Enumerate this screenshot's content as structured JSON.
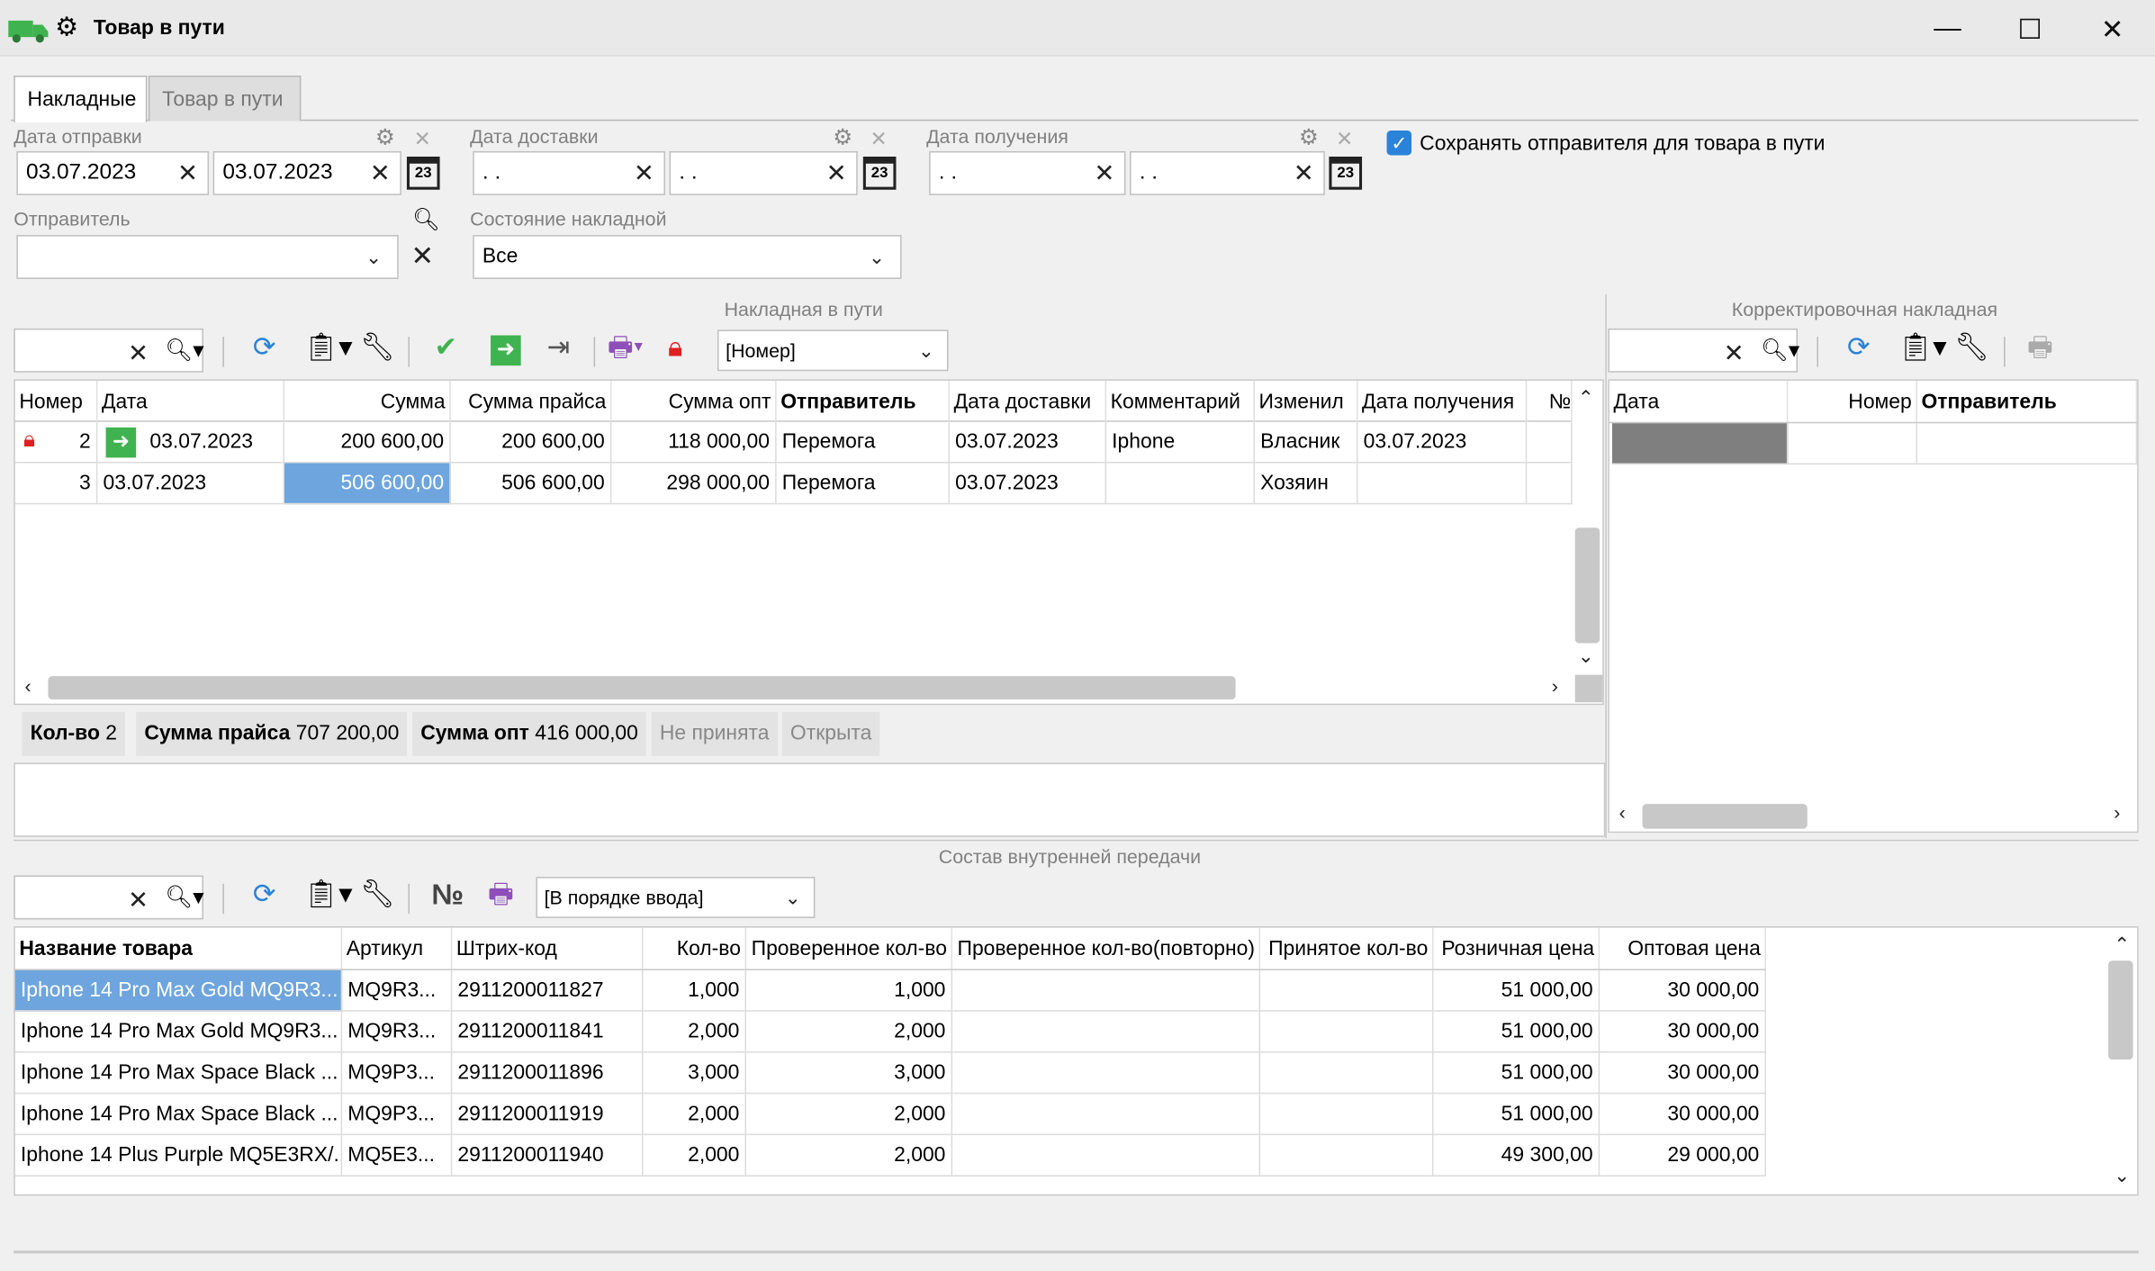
{
  "window": {
    "title": "Товар в пути",
    "minimize": "—",
    "maximize": "☐",
    "close": "✕"
  },
  "tabs": [
    "Накладные",
    "Товар в пути"
  ],
  "filters": {
    "ship_date": {
      "label": "Дата отправки",
      "from": "03.07.2023",
      "to": "03.07.2023"
    },
    "delivery_date": {
      "label": "Дата доставки",
      "from": " .  .",
      "to": " .  ."
    },
    "receive_date": {
      "label": "Дата получения",
      "from": " .  .",
      "to": " .  ."
    },
    "save_sender": {
      "label": "Сохранять отправителя для товара в пути",
      "checked": true
    },
    "sender": {
      "label": "Отправитель",
      "value": ""
    },
    "invoice_state": {
      "label": "Состояние накладной",
      "value": "Все"
    },
    "calendar_glyph": "23"
  },
  "invoices": {
    "section_title": "Накладная в пути",
    "sort_select": "[Номер]",
    "columns": [
      "Номер",
      "Дата",
      "Сумма",
      "Сумма прайса",
      "Сумма опт",
      "Отправитель",
      "Дата доставки",
      "Комментарий",
      "Изменил",
      "Дата получения",
      "№"
    ],
    "rows": [
      {
        "num": "2",
        "date": "03.07.2023",
        "sum": "200 600,00",
        "price_sum": "200 600,00",
        "opt_sum": "118 000,00",
        "sender": "Перемога",
        "delivery": "03.07.2023",
        "comment": "Iphone",
        "changed": "Власник",
        "received": "03.07.2023",
        "locked": true
      },
      {
        "num": "3",
        "date": "03.07.2023",
        "sum": "506 600,00",
        "price_sum": "506 600,00",
        "opt_sum": "298 000,00",
        "sender": "Перемога",
        "delivery": "03.07.2023",
        "comment": "",
        "changed": "Хозяин",
        "received": "",
        "locked": false
      }
    ],
    "summary": {
      "count_label": "Кол-во",
      "count": "2",
      "price_label": "Сумма прайса",
      "price": "707 200,00",
      "opt_label": "Сумма опт",
      "opt": "416 000,00",
      "status1": "Не принята",
      "status2": "Открыта"
    }
  },
  "corrections": {
    "section_title": "Корректировочная накладная",
    "columns": [
      "Дата",
      "Номер",
      "Отправитель"
    ]
  },
  "composition": {
    "section_title": "Состав внутренней передачи",
    "order_select": "[В порядке ввода]",
    "num_icon": "№",
    "columns": [
      "Название товара",
      "Артикул",
      "Штрих-код",
      "Кол-во",
      "Проверенное кол-во",
      "Проверенное кол-во(повторно)",
      "Принятое кол-во",
      "Розничная цена",
      "Оптовая цена"
    ],
    "rows": [
      {
        "name": "Iphone 14  Pro Max Gold MQ9R3...",
        "sku": "MQ9R3...",
        "barcode": "2911200011827",
        "qty": "1,000",
        "checked": "1,000",
        "checked2": "",
        "accepted": "",
        "retail": "51 000,00",
        "wholesale": "30 000,00"
      },
      {
        "name": "Iphone 14  Pro Max Gold MQ9R3...",
        "sku": "MQ9R3...",
        "barcode": "2911200011841",
        "qty": "2,000",
        "checked": "2,000",
        "checked2": "",
        "accepted": "",
        "retail": "51 000,00",
        "wholesale": "30 000,00"
      },
      {
        "name": "Iphone 14  Pro Max Space Black ...",
        "sku": "MQ9P3...",
        "barcode": "2911200011896",
        "qty": "3,000",
        "checked": "3,000",
        "checked2": "",
        "accepted": "",
        "retail": "51 000,00",
        "wholesale": "30 000,00"
      },
      {
        "name": "Iphone 14  Pro Max Space Black ...",
        "sku": "MQ9P3...",
        "barcode": "2911200011919",
        "qty": "2,000",
        "checked": "2,000",
        "checked2": "",
        "accepted": "",
        "retail": "51 000,00",
        "wholesale": "30 000,00"
      },
      {
        "name": "Iphone 14 Plus Purple MQ5E3RX/...",
        "sku": "MQ5E3...",
        "barcode": "2911200011940",
        "qty": "2,000",
        "checked": "2,000",
        "checked2": "",
        "accepted": "",
        "retail": "49 300,00",
        "wholesale": "29 000,00"
      }
    ]
  },
  "icons": {
    "truck": "truck-icon",
    "gear": "gear-icon",
    "search": "search-icon",
    "refresh": "refresh-icon",
    "clipboard": "clipboard-icon",
    "wrench": "wrench-icon",
    "check": "check-icon",
    "arrow": "arrow-right-icon",
    "print": "printer-icon",
    "lock": "lock-icon"
  },
  "colors": {
    "selection": "#6ea5de",
    "green": "#3fb34f",
    "lock": "#e02020",
    "blue_icon": "#2a83d8",
    "purple": "#8e4fb8"
  }
}
